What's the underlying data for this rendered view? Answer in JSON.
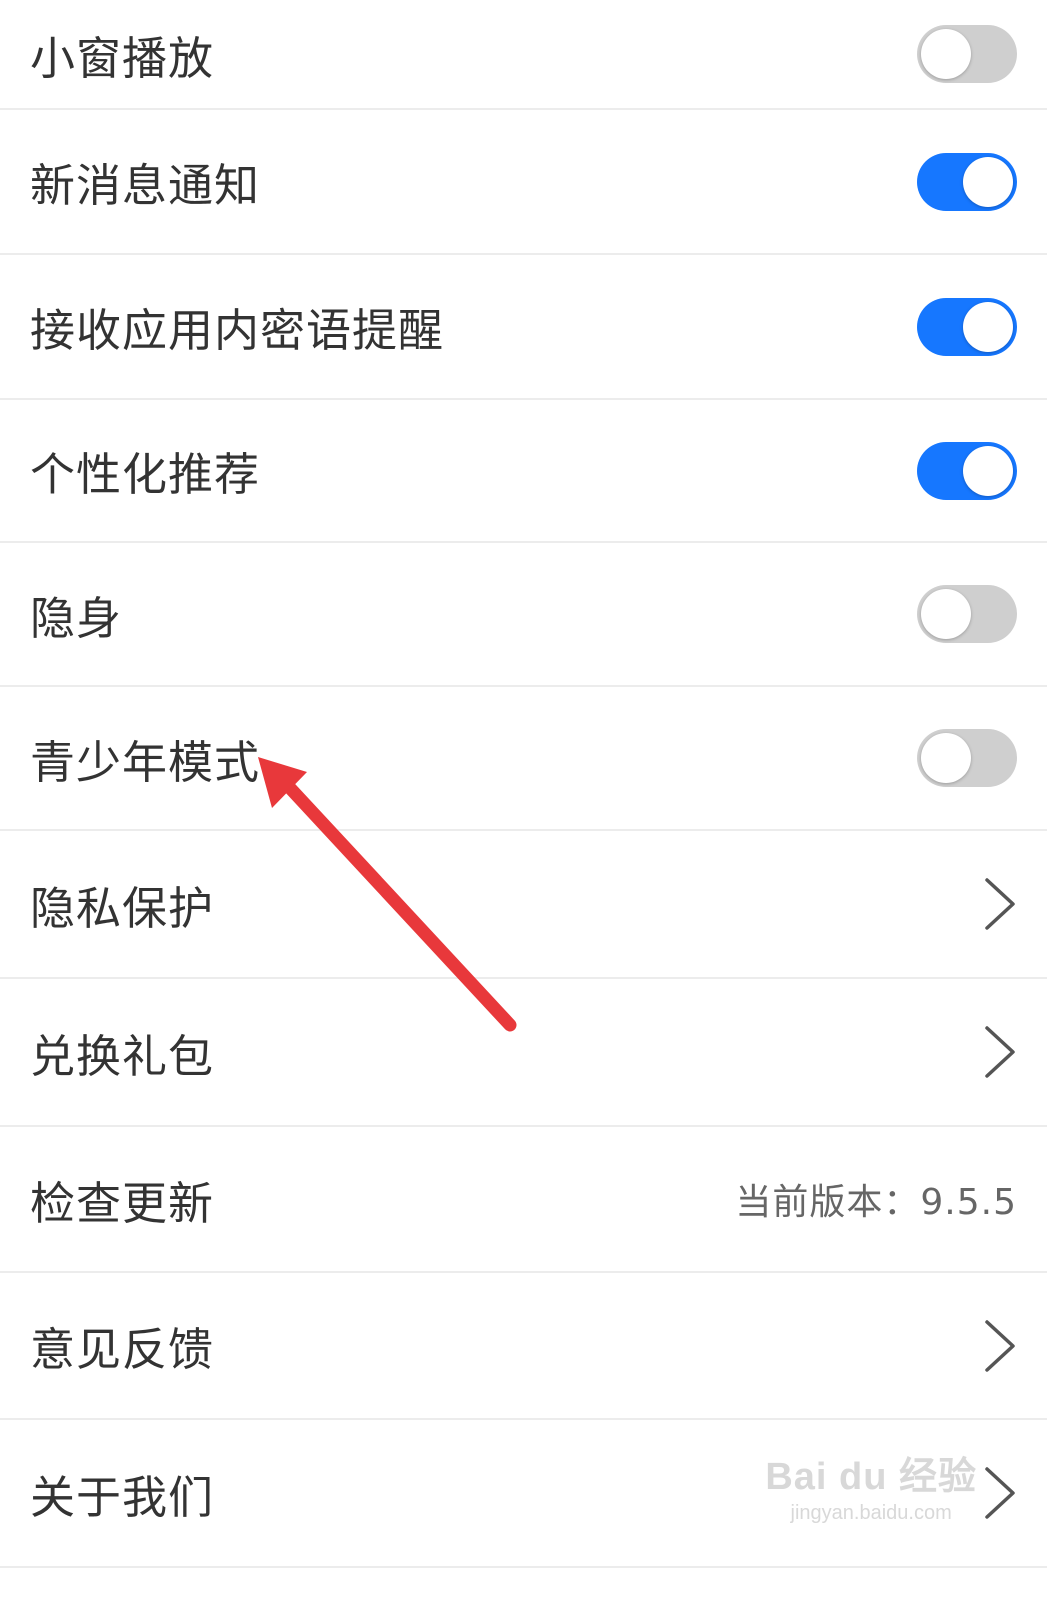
{
  "settings": [
    {
      "label": "小窗播放",
      "control": "toggle",
      "state": "off"
    },
    {
      "label": "新消息通知",
      "control": "toggle",
      "state": "on"
    },
    {
      "label": "接收应用内密语提醒",
      "control": "toggle",
      "state": "on"
    },
    {
      "label": "个性化推荐",
      "control": "toggle",
      "state": "on"
    },
    {
      "label": "隐身",
      "control": "toggle",
      "state": "off"
    },
    {
      "label": "青少年模式",
      "control": "toggle",
      "state": "off"
    },
    {
      "label": "隐私保护",
      "control": "chevron",
      "icon": "chevron-right-icon"
    },
    {
      "label": "兑换礼包",
      "control": "chevron",
      "icon": "chevron-right-icon"
    },
    {
      "label": "检查更新",
      "control": "value",
      "value": "当前版本：9.5.5"
    },
    {
      "label": "意见反馈",
      "control": "chevron",
      "icon": "chevron-right-icon"
    },
    {
      "label": "关于我们",
      "control": "chevron",
      "icon": "chevron-right-icon"
    }
  ],
  "colors": {
    "toggle_on": "#1677ff",
    "toggle_off": "#cfcfcf",
    "annotation_arrow": "#e8383b",
    "text": "#333333"
  },
  "watermark": {
    "main": "Bai du 经验",
    "sub": "jingyan.baidu.com"
  }
}
